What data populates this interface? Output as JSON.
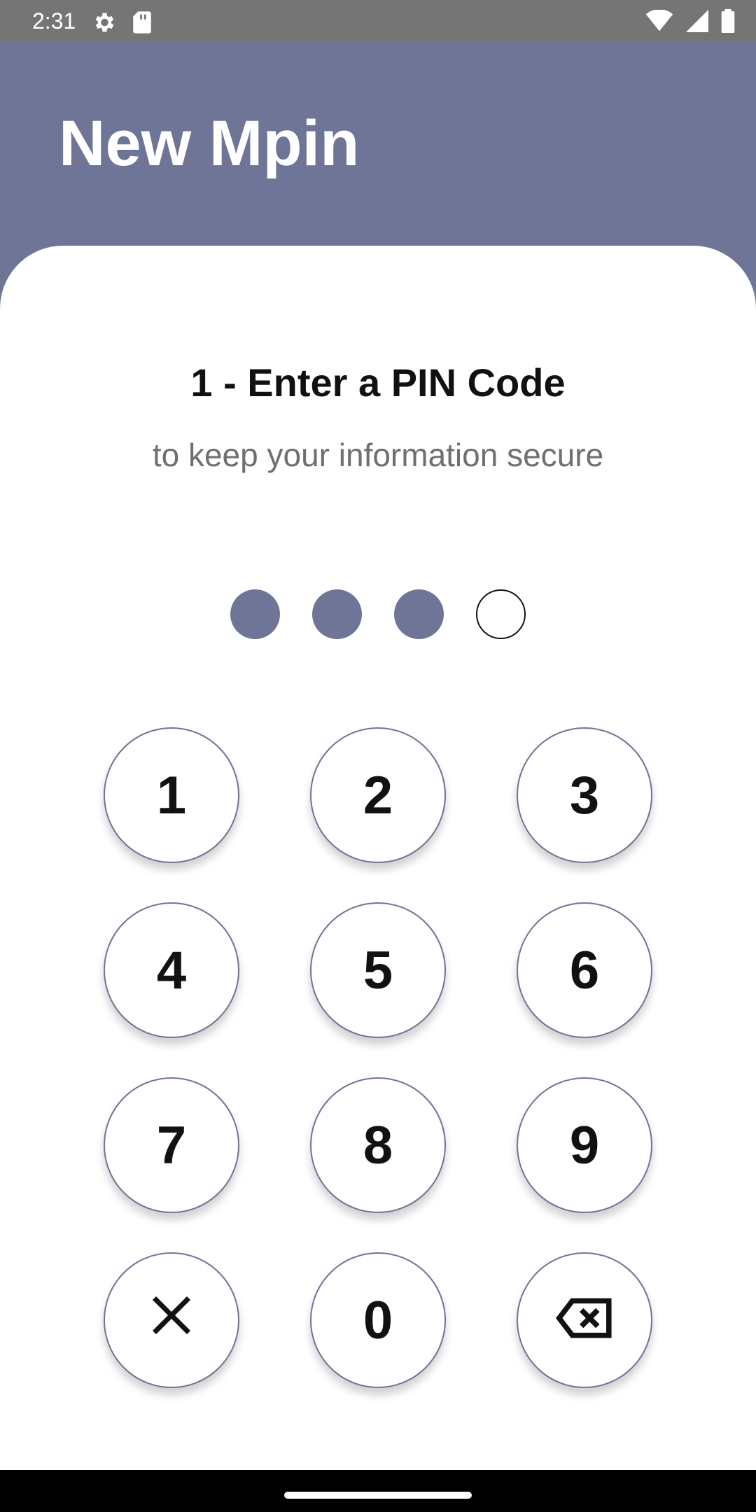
{
  "status_bar": {
    "time": "2:31",
    "icons": [
      "settings-gear-icon",
      "sd-card-icon",
      "wifi-icon",
      "signal-icon",
      "battery-icon"
    ]
  },
  "header": {
    "title": "New Mpin"
  },
  "pin_entry": {
    "step_title": "1 - Enter a PIN Code",
    "subtitle": "to keep your information secure",
    "digits_total": 4,
    "digits_entered": 3
  },
  "keypad": {
    "keys": [
      "1",
      "2",
      "3",
      "4",
      "5",
      "6",
      "7",
      "8",
      "9",
      "clear",
      "0",
      "backspace"
    ],
    "digits": {
      "k1": "1",
      "k2": "2",
      "k3": "3",
      "k4": "4",
      "k5": "5",
      "k6": "6",
      "k7": "7",
      "k8": "8",
      "k9": "9",
      "k0": "0"
    },
    "clear_icon": "close-icon",
    "backspace_icon": "backspace-icon"
  },
  "colors": {
    "primary": "#6e7596",
    "status_bar": "#757575",
    "card_background": "#ffffff",
    "subtitle_text": "#6f6f6f",
    "nav_bar": "#000000"
  }
}
